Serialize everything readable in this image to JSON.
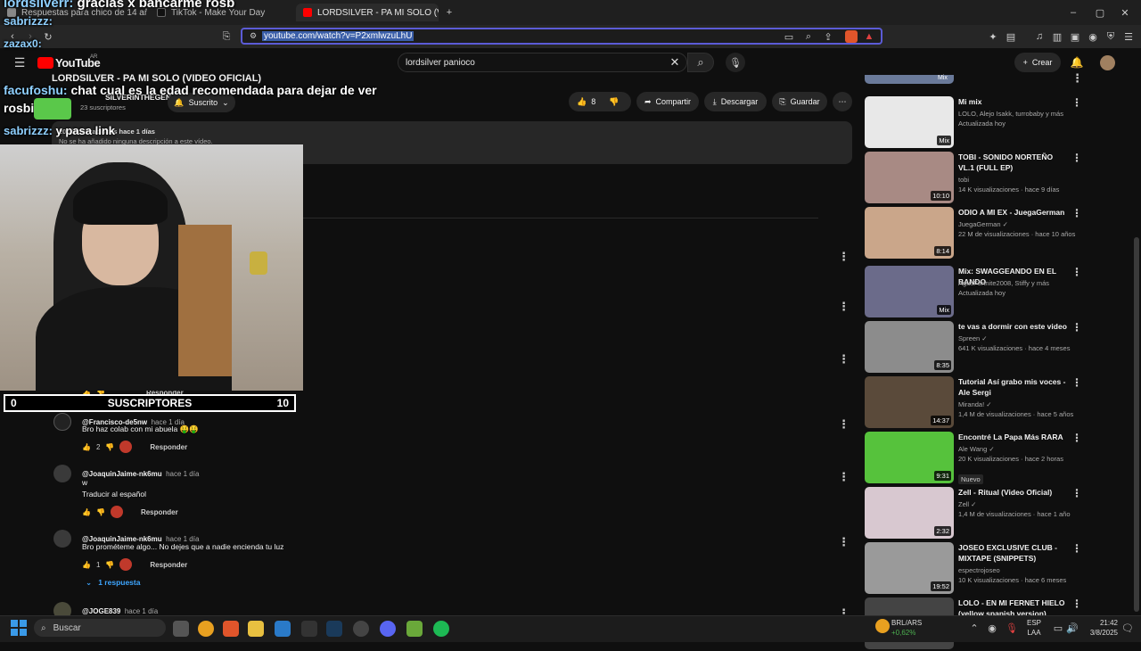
{
  "browser": {
    "tabs": [
      {
        "label": "Respuestas para chico de 14 años",
        "color": "#888888"
      },
      {
        "label": "TikTok - Make Your Day",
        "color": "#111111"
      },
      {
        "label": "LORDSILVER - PA MI SOLO (VIDE",
        "color": "#ff0000"
      }
    ],
    "url_display": "youtube.com/watch?v=P2xmlwzuLhU"
  },
  "youtube": {
    "logo": "YouTube",
    "region": "AR",
    "search_value": "lordsilver panioco",
    "create_label": "Crear",
    "video_title": "LORDSILVER - PA MI SOLO (VIDEO OFICIAL)",
    "channel_name": "SILVERINTHEGENG",
    "subscribers": "23 suscriptores",
    "subscribed_label": "Suscrito",
    "likes": "8",
    "share_label": "Compartir",
    "download_label": "Descargar",
    "save_label": "Guardar",
    "desc_meta": "20 visualizaciones hace 1 días",
    "desc_text": "No se ha añadido ninguna descripción a este vídeo."
  },
  "stream_overlay": {
    "chat": [
      {
        "name": "lordsilverr:",
        "text": "gracias x bancarme rosb"
      },
      {
        "name": "sabrizzz:",
        "text": ""
      },
      {
        "name": "zazax0:",
        "text": ""
      },
      {
        "name": "facufoshu:",
        "text": "chat cual es la edad recomendada para dejar de ver"
      },
      {
        "name": "",
        "text": "rosbi"
      },
      {
        "name": "sabrizzz:",
        "text": "y pasa link"
      }
    ],
    "sub_counter": {
      "left": "0",
      "label": "SUSCRIPTORES",
      "right": "10"
    }
  },
  "comments": [
    {
      "author": "@Francisco-de5nw",
      "time": "hace 1 día",
      "text": "Bro haz colab con mi abuela 🤑🤑",
      "likes": "2",
      "reply_label": "Responder"
    },
    {
      "author": "@JoaquinJaime-nk6mu",
      "time": "hace 1 día",
      "text": "w\nTraducir al español",
      "likes": "",
      "reply_label": "Responder"
    },
    {
      "author": "@JoaquinJaime-nk6mu",
      "time": "hace 1 día",
      "text": "Bro prométeme algo... No dejes que a nadie encienda tu luz",
      "likes": "1",
      "reply_label": "Responder"
    },
    {
      "author": "@JOGE839",
      "time": "hace 1 día",
      "text": "",
      "likes": "",
      "reply_label": ""
    }
  ],
  "partial_reply_label": "Responder",
  "replies_link": "1 respuesta",
  "sidebar": [
    {
      "title": "Mi mix",
      "meta1": "LOLO, Alejo Isakk, turrobaby y más",
      "meta2": "Actualizada hoy",
      "dur": "Mix",
      "color": "#e8e8e8"
    },
    {
      "title": "TOBI - SONIDO NORTEÑO VL.1 (FULL EP)",
      "meta1": "tobi",
      "meta2": "14 K visualizaciones · hace 9 días",
      "dur": "10:10",
      "color": "#a88a84"
    },
    {
      "title": "ODIO A MI EX - JuegaGerman",
      "meta1": "JuegaGerman ✓",
      "meta2": "22 M de visualizaciones · hace 10 años",
      "dur": "8:14",
      "color": "#caa68a"
    },
    {
      "title": "Mix: SWAGGEANDO EN EL BANDO",
      "meta1": "AgusFortnite2008, Stiffy y más",
      "meta2": "Actualizada hoy",
      "dur": "Mix",
      "color": "#6b6b8a"
    },
    {
      "title": "te vas a dormir con este video",
      "meta1": "Spreen ✓",
      "meta2": "641 K visualizaciones · hace 4 meses",
      "dur": "8:35",
      "color": "#8c8c8c"
    },
    {
      "title": "Tutorial Así grabo mis voces - Ale Sergi",
      "meta1": "Miranda! ✓",
      "meta2": "1,4 M de visualizaciones · hace 5 años",
      "dur": "14:37",
      "color": "#5a4a3a"
    },
    {
      "title": "Encontré La Papa Más RARA",
      "meta1": "Ale Wang ✓",
      "meta2": "20 K visualizaciones · hace 2 horas",
      "badge": "Nuevo",
      "dur": "9:31",
      "color": "#56c23c"
    },
    {
      "title": "Zell - Ritual (Video Oficial)",
      "meta1": "Zell ✓",
      "meta2": "1,4 M de visualizaciones · hace 1 año",
      "dur": "2:32",
      "color": "#d8c8d0"
    },
    {
      "title": "JOSEO EXCLUSIVE CLUB - MIXTAPE (SNIPPETS)",
      "meta1": "espectrojoseo",
      "meta2": "10 K visualizaciones · hace 6 meses",
      "dur": "19:52",
      "color": "#9a9a9a"
    },
    {
      "title": "LOLO - EN MI FERNET HIELO (yellow spanish version)",
      "meta1": "",
      "meta2": "",
      "dur": "",
      "color": "#444"
    }
  ],
  "taskbar": {
    "search_label": "Buscar",
    "ticker": "BRL/ARS",
    "ticker_change": "+0,62%",
    "lang1": "ESP",
    "lang2": "LAA",
    "time": "21:42",
    "date": "3/8/2025"
  }
}
